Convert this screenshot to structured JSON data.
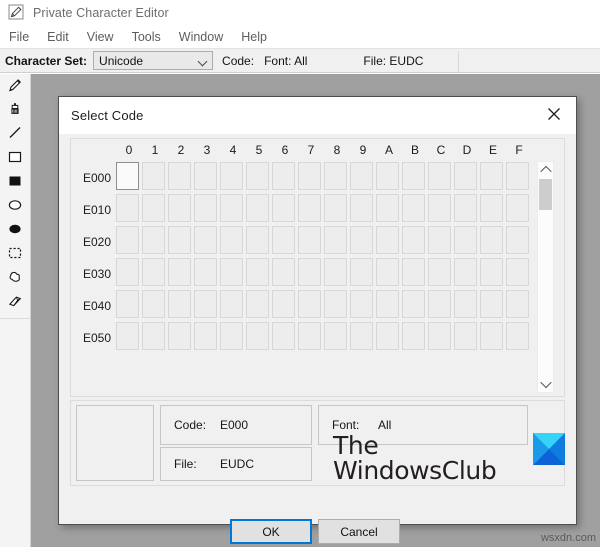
{
  "app": {
    "title": "Private Character Editor",
    "title_icon": "pencil-edit-icon"
  },
  "menu": {
    "items": [
      {
        "label": "File"
      },
      {
        "label": "Edit"
      },
      {
        "label": "View"
      },
      {
        "label": "Tools"
      },
      {
        "label": "Window"
      },
      {
        "label": "Help"
      }
    ]
  },
  "charset_bar": {
    "label": "Character Set:",
    "combo_value": "Unicode",
    "combo_options": [
      "Unicode"
    ],
    "code_field": "Code:",
    "font_field": "Font: All",
    "file_field": "File: EUDC"
  },
  "tools": {
    "items": [
      {
        "name": "pencil-tool",
        "icon": "pencil-icon"
      },
      {
        "name": "brush-tool",
        "icon": "brush-icon"
      },
      {
        "name": "straight-line-tool",
        "icon": "line-icon"
      },
      {
        "name": "rectangle-tool",
        "icon": "rectangle-outline-icon"
      },
      {
        "name": "filled-rectangle-tool",
        "icon": "rectangle-filled-icon"
      },
      {
        "name": "ellipse-tool",
        "icon": "ellipse-outline-icon"
      },
      {
        "name": "filled-ellipse-tool",
        "icon": "ellipse-filled-icon"
      },
      {
        "name": "rectangular-selection-tool",
        "icon": "dashed-rectangle-icon"
      },
      {
        "name": "freeform-selection-tool",
        "icon": "freeform-selection-icon"
      },
      {
        "name": "eraser-tool",
        "icon": "eraser-icon"
      }
    ]
  },
  "dialog": {
    "title": "Select Code",
    "close_icon": "close-icon",
    "grid": {
      "columns": [
        "0",
        "1",
        "2",
        "3",
        "4",
        "5",
        "6",
        "7",
        "8",
        "9",
        "A",
        "B",
        "C",
        "D",
        "E",
        "F"
      ],
      "rows": [
        "E000",
        "E010",
        "E020",
        "E030",
        "E040",
        "E050"
      ],
      "selected_cell": "E000",
      "selected_row_index": 0,
      "selected_col_index": 0
    },
    "scrollbar": {
      "up_icon": "chevron-up-icon",
      "down_icon": "chevron-down-icon"
    },
    "info": {
      "code_key": "Code:",
      "code_value": "E000",
      "file_key": "File:",
      "file_value": "EUDC",
      "font_key": "Font:",
      "font_value": "All"
    },
    "buttons": {
      "ok": "OK",
      "cancel": "Cancel"
    }
  },
  "watermark": {
    "logo_line1": "The",
    "logo_line2": "WindowsClub",
    "logo_mark": "windowsclub-diamond-icon",
    "bottom_text": "wsxdn.com"
  },
  "colors": {
    "accent": "#0078d7",
    "logo_cyan": "#22c8f2",
    "logo_blue": "#0a6fd8",
    "window_bg": "#f0f0f0",
    "workspace_bg": "#9e9e9e"
  }
}
